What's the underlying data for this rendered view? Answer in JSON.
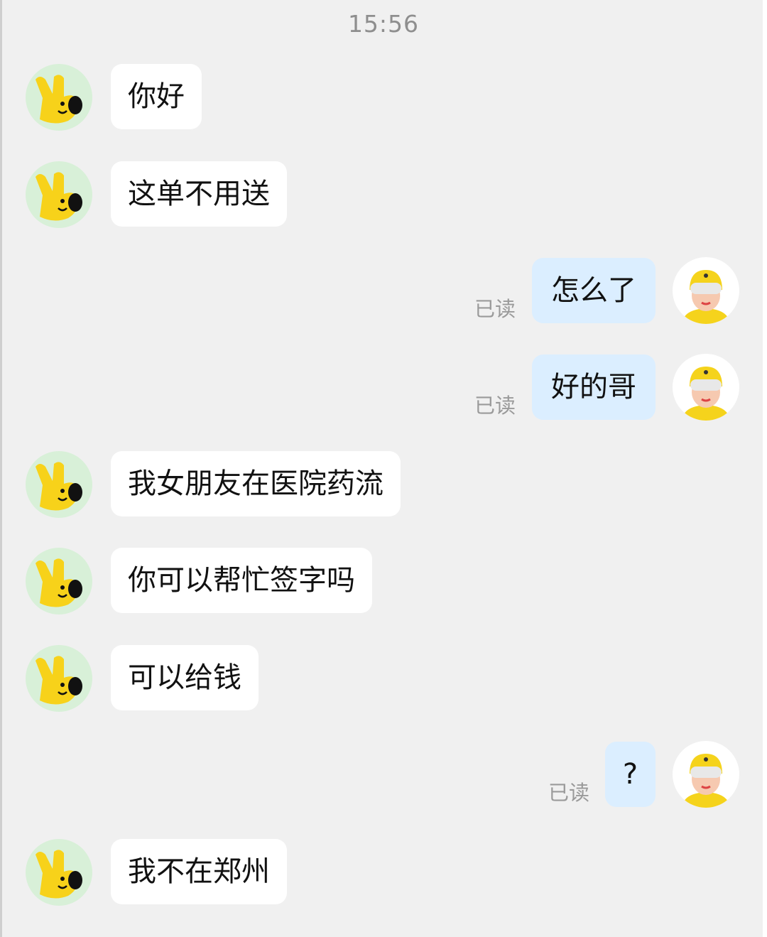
{
  "header": {
    "time": "15:56"
  },
  "messages": [
    {
      "side": "left",
      "text": "你好"
    },
    {
      "side": "left",
      "text": "这单不用送"
    },
    {
      "side": "right",
      "text": "怎么了",
      "status": "已读"
    },
    {
      "side": "right",
      "text": "好的哥",
      "status": "已读"
    },
    {
      "side": "left",
      "text": "我女朋友在医院药流"
    },
    {
      "side": "left",
      "text": "你可以帮忙签字吗"
    },
    {
      "side": "left",
      "text": "可以给钱"
    },
    {
      "side": "right",
      "text": "?",
      "status": "已读"
    },
    {
      "side": "left",
      "text": "我不在郑州"
    }
  ],
  "avatars": {
    "customer": {
      "icon": "yellow-hand-mascot-icon",
      "bg": "#d8f0d8",
      "color": "#f7d21a"
    },
    "rider": {
      "icon": "rider-helmet-avatar-icon",
      "bg": "#ffffff",
      "color": "#f5d31c"
    }
  },
  "colors": {
    "background": "#f0f0f0",
    "left_bubble": "#ffffff",
    "right_bubble": "#dbeeff",
    "read_text": "#9a9a9a"
  }
}
